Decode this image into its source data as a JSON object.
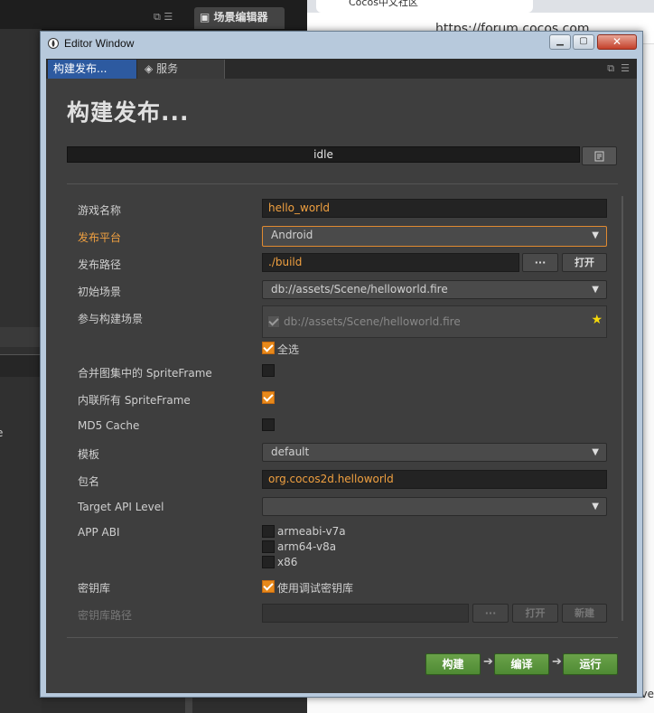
{
  "background": {
    "editor_tab": "场景编辑器",
    "browser_tab": "Cocos中文社区",
    "browser_url": "https://forum.cocos.com",
    "browser_partial": "ve"
  },
  "window": {
    "title": "Editor Window",
    "tabs": [
      {
        "label": "构建发布..."
      },
      {
        "label": "服务"
      }
    ]
  },
  "panel": {
    "heading": "构建发布...",
    "status": "idle",
    "fields": {
      "game_name": {
        "label": "游戏名称",
        "value": "hello_world"
      },
      "platform": {
        "label": "发布平台",
        "value": "Android"
      },
      "build_path": {
        "label": "发布路径",
        "value": "./build",
        "browse": "···",
        "open": "打开"
      },
      "start_scene": {
        "label": "初始场景",
        "value": "db://assets/Scene/helloworld.fire"
      },
      "included_scenes": {
        "label": "参与构建场景",
        "scene": "db://assets/Scene/helloworld.fire",
        "select_all": "全选"
      },
      "merge_spriteframe": {
        "label": "合并图集中的 SpriteFrame"
      },
      "inline_spriteframe": {
        "label": "内联所有 SpriteFrame"
      },
      "md5_cache": {
        "label": "MD5 Cache"
      },
      "template": {
        "label": "模板",
        "value": "default"
      },
      "package_name": {
        "label": "包名",
        "value": "org.cocos2d.helloworld"
      },
      "target_api": {
        "label": "Target API Level",
        "value": ""
      },
      "app_abi": {
        "label": "APP ABI",
        "options": [
          "armeabi-v7a",
          "arm64-v8a",
          "x86"
        ]
      },
      "keystore": {
        "label": "密钥库",
        "option": "使用调试密钥库"
      },
      "keystore_path": {
        "label": "密钥库路径",
        "browse": "···",
        "open": "打开",
        "new": "新建"
      }
    },
    "actions": {
      "build": "构建",
      "compile": "编译",
      "run": "运行"
    }
  },
  "colors": {
    "accent_orange": "#f0a040",
    "button_green": "#5a953e",
    "tab_active": "#2d5aa0"
  }
}
